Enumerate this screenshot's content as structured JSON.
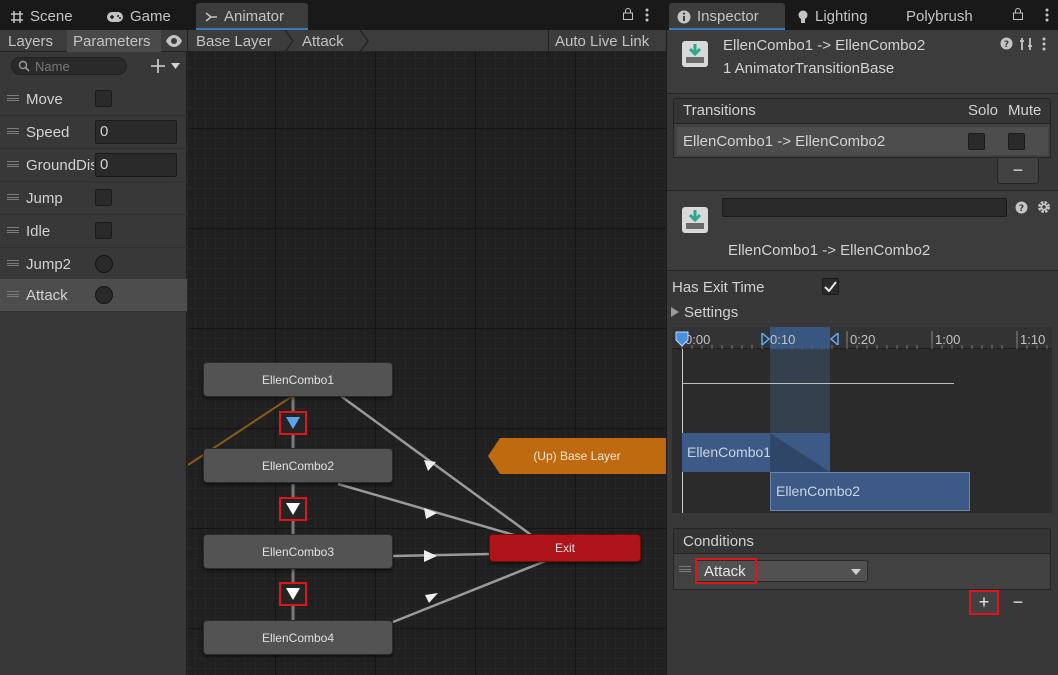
{
  "left_tabs": {
    "scene": "Scene",
    "game": "Game",
    "animator": "Animator"
  },
  "animator_toolbar": {
    "layers_tab": "Layers",
    "parameters_tab": "Parameters",
    "breadcrumb": [
      "Base Layer",
      "Attack"
    ],
    "auto_live_link": "Auto Live Link"
  },
  "parameters": {
    "search_placeholder": "Name",
    "items": [
      {
        "name": "Move",
        "type": "bool"
      },
      {
        "name": "Speed",
        "type": "float",
        "value": "0"
      },
      {
        "name": "GroundDistance",
        "type": "float",
        "value": "0"
      },
      {
        "name": "Jump",
        "type": "bool"
      },
      {
        "name": "Idle",
        "type": "bool"
      },
      {
        "name": "Jump2",
        "type": "trigger"
      },
      {
        "name": "Attack",
        "type": "trigger",
        "selected": true
      }
    ]
  },
  "graph": {
    "states": [
      "EllenCombo1",
      "EllenCombo2",
      "EllenCombo3",
      "EllenCombo4"
    ],
    "exit_label": "Exit",
    "up_label": "(Up) Base Layer"
  },
  "inspector_tabs": {
    "inspector": "Inspector",
    "lighting": "Lighting",
    "polybrush": "Polybrush"
  },
  "inspector": {
    "header_title": "EllenCombo1 -> EllenCombo2",
    "header_subtitle": "1 AnimatorTransitionBase",
    "transitions_header": "Transitions",
    "solo_header": "Solo",
    "mute_header": "Mute",
    "transition_row": "EllenCombo1 -> EllenCombo2",
    "transition_name_value": "",
    "transition_caption": "EllenCombo1 -> EllenCombo2",
    "has_exit_time_label": "Has Exit Time",
    "has_exit_time": true,
    "settings_label": "Settings",
    "timeline_ticks": [
      "0:00",
      "0:10",
      "0:20",
      "1:00",
      "1:10"
    ],
    "timeline_from_state": "EllenCombo1",
    "timeline_to_state": "EllenCombo2",
    "conditions_header": "Conditions",
    "condition_param": "Attack",
    "add_symbol": "+",
    "remove_symbol": "−"
  },
  "colors": {
    "accent_blue": "#3a79bb",
    "highlight_red": "#e0151b",
    "exit_red": "#b0141b",
    "up_orange": "#c06a10",
    "transition_bar_blue": "#3d5a86"
  }
}
